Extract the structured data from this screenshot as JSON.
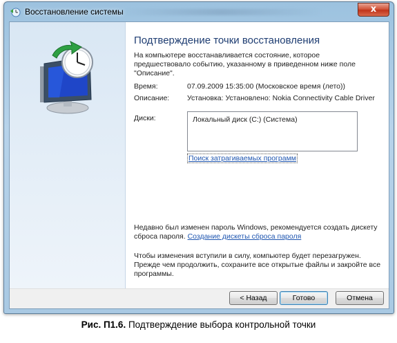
{
  "window": {
    "title": "Восстановление системы",
    "close_glyph": "x"
  },
  "page": {
    "heading": "Подтверждение точки восстановления",
    "intro": "На компьютере восстанавливается состояние, которое предшествовало событию, указанному в приведенном ниже поле \"Описание\".",
    "time_label": "Время:",
    "time_value": "07.09.2009 15:35:00 (Московское время (лето))",
    "description_label": "Описание:",
    "description_value": "Установка: Установлено: Nokia Connectivity Cable Driver",
    "disks_label": "Диски:",
    "disks": [
      "Локальный диск (C:) (Система)"
    ],
    "affected_programs_link": "Поиск затрагиваемых программ",
    "password_note": "Недавно был изменен пароль Windows, рекомендуется создать дискету сброса пароля.",
    "password_link": "Создание дискеты сброса пароля",
    "restart_note": "Чтобы изменения вступили в силу, компьютер будет перезагружен. Прежде чем продолжить, сохраните все открытые файлы и закройте все программы."
  },
  "buttons": {
    "back": "< Назад",
    "finish": "Готово",
    "cancel": "Отмена"
  },
  "caption": {
    "label": "Рис. П1.6.",
    "text": " Подтверждение выбора контрольной точки"
  },
  "icons": {
    "app": "system-restore-icon",
    "illustration": "monitor-clock-restore-icon"
  }
}
